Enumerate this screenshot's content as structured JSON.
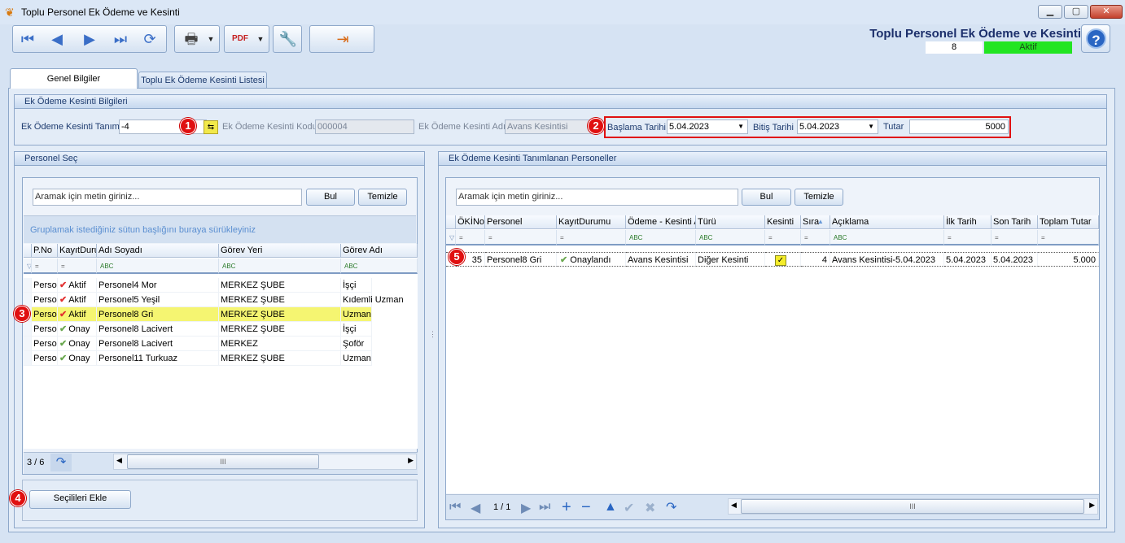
{
  "window": {
    "title": "Toplu Personel Ek Ödeme ve Kesinti",
    "min": "▁",
    "max": "▢",
    "close": "✕"
  },
  "header": {
    "title": "Toplu Personel Ek Ödeme ve Kesinti",
    "record_no": "8",
    "status": "Aktif",
    "status_color": "#22e522",
    "help": "?"
  },
  "toolbar": {
    "icons": [
      "first-record-icon",
      "prev-record-icon",
      "next-record-icon",
      "last-record-icon",
      "refresh-icon",
      "print-icon",
      "pdf-export-icon",
      "settings-icon",
      "exit-icon"
    ]
  },
  "tabs": [
    {
      "label": "Genel Bilgiler"
    },
    {
      "label": "Toplu Ek Ödeme Kesinti Listesi"
    }
  ],
  "info": {
    "group_title": "Ek Ödeme Kesinti Bilgileri",
    "tanim_label": "Ek Ödeme Kesinti Tanımı",
    "tanim_value": "-4",
    "kod_label": "Ek Ödeme Kesinti Kodu",
    "kod_value": "000004",
    "ad_label": "Ek Ödeme Kesinti Adı",
    "ad_value": "Avans Kesintisi",
    "baslama_label": "Başlama Tarihi",
    "baslama_value": "5.04.2023",
    "bitis_label": "Bitiş Tarihi",
    "bitis_value": "5.04.2023",
    "tutar_label": "Tutar",
    "tutar_value": "5000"
  },
  "badges": [
    "1",
    "2",
    "3",
    "4",
    "5"
  ],
  "left": {
    "group_title": "Personel Seç",
    "search_placeholder": "Aramak için metin giriniz...",
    "find_label": "Bul",
    "clear_label": "Temizle",
    "group_hint": "Gruplamak istediğiniz sütun başlığını buraya sürükleyiniz",
    "columns": [
      "P.No",
      "KayıtDurumu",
      "Adı Soyadı",
      "Görev Yeri",
      "Görev Adı"
    ],
    "filters": [
      "=",
      "=",
      "ABC",
      "ABC",
      "ABC"
    ],
    "rows": [
      {
        "pno": "Perso",
        "mark": "red",
        "durum": "Aktif",
        "ad": "Personel4 Mor",
        "yer": "MERKEZ ŞUBE",
        "gorev": "İşçi"
      },
      {
        "pno": "Perso",
        "mark": "red",
        "durum": "Aktif",
        "ad": "Personel5 Yeşil",
        "yer": "MERKEZ ŞUBE",
        "gorev": "Kıdemli Uzman"
      },
      {
        "pno": "Perso",
        "mark": "red",
        "durum": "Aktif",
        "ad": "Personel8 Gri",
        "yer": "MERKEZ ŞUBE",
        "gorev": "Uzman"
      },
      {
        "pno": "Perso",
        "mark": "green",
        "durum": "Onay",
        "ad": "Personel8 Lacivert",
        "yer": "MERKEZ ŞUBE",
        "gorev": "İşçi"
      },
      {
        "pno": "Perso",
        "mark": "green",
        "durum": "Onay",
        "ad": "Personel8 Lacivert",
        "yer": "MERKEZ",
        "gorev": "Şoför"
      },
      {
        "pno": "Perso",
        "mark": "green",
        "durum": "Onay",
        "ad": "Personel11 Turkuaz",
        "yer": "MERKEZ ŞUBE",
        "gorev": "Uzman"
      }
    ],
    "pager": "3 / 6",
    "add_label": "Seçilileri Ekle",
    "scroll_grip": "III"
  },
  "right": {
    "group_title": "Ek Ödeme Kesinti Tanımlanan Personeller",
    "search_placeholder": "Aramak için metin giriniz...",
    "find_label": "Bul",
    "clear_label": "Temizle",
    "columns": [
      "ÖKİNo",
      "Personel",
      "KayıtDurumu",
      "Ödeme - Kesinti Adı",
      "Türü",
      "Kesinti",
      "Sıra",
      "Açıklama",
      "İlk Tarih",
      "Son Tarih",
      "Toplam Tutar"
    ],
    "filters": [
      "=",
      "=",
      "=",
      "ABC",
      "ABC",
      "=",
      "=",
      "ABC",
      "=",
      "=",
      "="
    ],
    "row": {
      "okino": "35",
      "personel": "Personel8 Gri",
      "durum": "Onaylandı",
      "odeme": "Avans Kesintisi",
      "turu": "Diğer Kesinti",
      "kesinti": "✓",
      "sira": "4",
      "aciklama": "Avans Kesintisi-5.04.2023",
      "ilk": "5.04.2023",
      "son": "5.04.2023",
      "toplam": "5.000"
    },
    "pager": "1 / 1",
    "scroll_grip": "III"
  }
}
